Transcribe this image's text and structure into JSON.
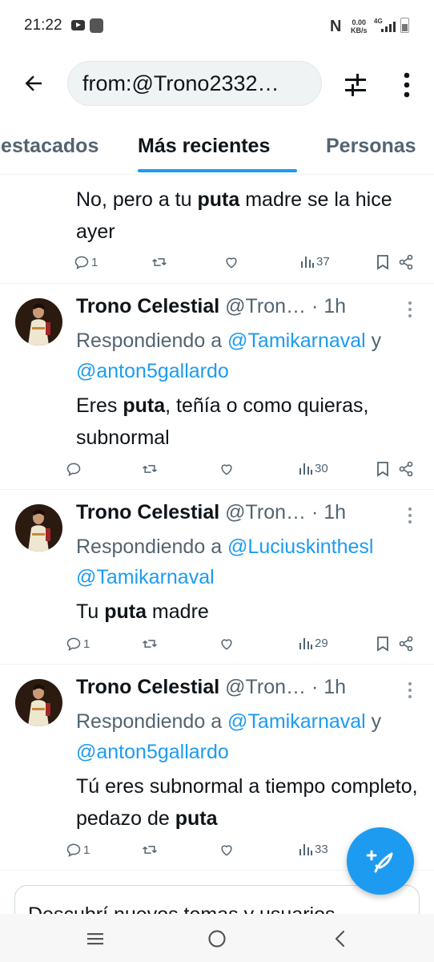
{
  "status_bar": {
    "time": "21:22",
    "nfc_label": "N",
    "speed_value": "0.00",
    "speed_unit": "KB/s",
    "network": "4G"
  },
  "header": {
    "search_query": "from:@Trono2332…"
  },
  "tabs": [
    {
      "label": "Destacados",
      "active": false
    },
    {
      "label": "Más recientes",
      "active": true
    },
    {
      "label": "Personas",
      "active": false
    }
  ],
  "tweets": [
    {
      "text_before": "No, pero a tu ",
      "text_bold": "puta",
      "text_after": " madre se la hice ayer",
      "replies": "1",
      "views": "37"
    },
    {
      "name": "Trono Celestial",
      "handle": "@Tron…",
      "dot": "·",
      "time": "1h",
      "replying_prefix": "Respondiendo a",
      "replying_to_1": "@Tamikarnaval",
      "replying_join": "y",
      "replying_to_2": "@anton5gallardo",
      "text_before": "Eres ",
      "text_bold": "puta",
      "text_after": ", teñía o como quieras, subnormal",
      "replies": "",
      "views": "30"
    },
    {
      "name": "Trono Celestial",
      "handle": "@Tron…",
      "dot": "·",
      "time": "1h",
      "replying_prefix": "Respondiendo a",
      "replying_to_1": "@Luciuskinthesl",
      "replying_join": "",
      "replying_to_2": "@Tamikarnaval",
      "text_before": "Tu ",
      "text_bold": "puta",
      "text_after": " madre",
      "replies": "1",
      "views": "29"
    },
    {
      "name": "Trono Celestial",
      "handle": "@Tron…",
      "dot": "·",
      "time": "1h",
      "replying_prefix": "Respondiendo a",
      "replying_to_1": "@Tamikarnaval",
      "replying_join": "y",
      "replying_to_2": "@anton5gallardo",
      "text_before": "Tú eres subnormal a tiempo completo, pedazo de ",
      "text_bold": "puta",
      "text_after": "",
      "replies": "1",
      "views": "33"
    }
  ],
  "prompt_card": {
    "text": "Descubrí nuevos temas y usuarios"
  },
  "colors": {
    "accent": "#1d9bf0",
    "secondary_text": "#536471",
    "primary_text": "#0f1419"
  }
}
